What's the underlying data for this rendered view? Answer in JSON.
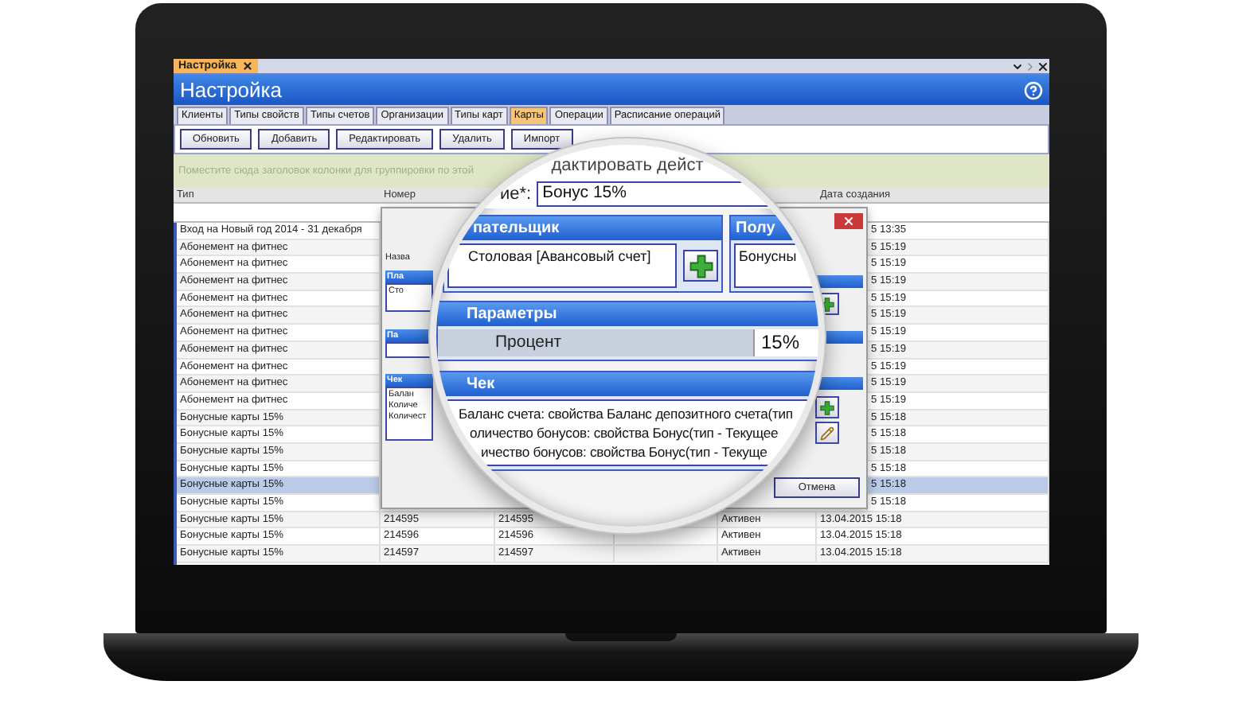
{
  "window_tab": {
    "label": "Настройка"
  },
  "header": {
    "title": "Настройка"
  },
  "tabs": [
    {
      "label": "Клиенты",
      "selected": false
    },
    {
      "label": "Типы свойств",
      "selected": false
    },
    {
      "label": "Типы счетов",
      "selected": false
    },
    {
      "label": "Организации",
      "selected": false
    },
    {
      "label": "Типы карт",
      "selected": false
    },
    {
      "label": "Карты",
      "selected": true
    },
    {
      "label": "Операции",
      "selected": false
    },
    {
      "label": "Расписание операций",
      "selected": false
    }
  ],
  "toolbar": {
    "buttons": [
      "Обновить",
      "Добавить",
      "Редактировать",
      "Удалить",
      "Импорт"
    ]
  },
  "group_hint": "Поместите сюда заголовок колонки для группировки по этой",
  "table": {
    "columns": [
      "Тип",
      "Номер",
      "Дата создания"
    ],
    "rows": [
      {
        "type": "Вход на Новый год 2014 - 31 декабря",
        "date": "5 13:35",
        "selected": false
      },
      {
        "type": "Абонемент на фитнес",
        "date": "5 15:19",
        "selected": false
      },
      {
        "type": "Абонемент на фитнес",
        "date": "5 15:19",
        "selected": false
      },
      {
        "type": "Абонемент на фитнес",
        "date": "5 15:19",
        "selected": false
      },
      {
        "type": "Абонемент на фитнес",
        "date": "5 15:19",
        "selected": false
      },
      {
        "type": "Абонемент на фитнес",
        "date": "5 15:19",
        "selected": false
      },
      {
        "type": "Абонемент на фитнес",
        "date": "5 15:19",
        "selected": false
      },
      {
        "type": "Абонемент на фитнес",
        "date": "5 15:19",
        "selected": false
      },
      {
        "type": "Абонемент на фитнес",
        "date": "5 15:19",
        "selected": false
      },
      {
        "type": "Абонемент на фитнес",
        "date": "5 15:19",
        "selected": false
      },
      {
        "type": "Абонемент на фитнес",
        "date": "5 15:19",
        "selected": false
      },
      {
        "type": "Бонусные карты 15%",
        "date": "5 15:18",
        "selected": false
      },
      {
        "type": "Бонусные карты 15%",
        "date": "5 15:18",
        "selected": false
      },
      {
        "type": "Бонусные карты 15%",
        "date": "5 15:18",
        "selected": false
      },
      {
        "type": "Бонусные карты 15%",
        "date": "5 15:18",
        "selected": false
      },
      {
        "type": "Бонусные карты 15%",
        "date": "5 15:18",
        "selected": true
      },
      {
        "type": "Бонусные карты 15%",
        "date": "5 15:18",
        "selected": false
      },
      {
        "type": "Бонусные карты 15%",
        "number": "214595",
        "column_3": "214595",
        "column_5": "Активен",
        "date": "13.04.2015 15:18",
        "selected": false
      },
      {
        "type": "Бонусные карты 15%",
        "number": "214596",
        "column_3": "214596",
        "column_5": "Активен",
        "date": "13.04.2015 15:18",
        "selected": false
      },
      {
        "type": "Бонусные карты 15%",
        "number": "214597",
        "column_3": "214597",
        "column_5": "Активен",
        "date": "13.04.2015 15:18",
        "selected": false
      }
    ]
  },
  "dialog": {
    "name_label": "Назва",
    "payer_header": "Пла",
    "payer_value": "Сто",
    "params_header": "Па",
    "check_header": "Чек",
    "check_lines": [
      "Балан",
      "Количе",
      "Количест"
    ],
    "cancel_button": "Отмена"
  },
  "magnifier": {
    "title": "дактировать дейст",
    "name_label": "ие*:",
    "name_value": "Бонус 15%",
    "payer_header": "пательщик",
    "payer_value": "Столовая [Авансовый счет]",
    "receiver_header": "Полу",
    "receiver_value": "Бонусны",
    "params_header": "Параметры",
    "params": [
      {
        "name": "Процент",
        "value": "15%"
      }
    ],
    "check_header": "Чек",
    "check_lines": [
      "Баланс счета: свойства Баланс депозитного счета(тип",
      "оличество бонусов: свойства Бонус(тип - Текущее",
      "ичество бонусов: свойства Бонус(тип - Текуще"
    ]
  }
}
